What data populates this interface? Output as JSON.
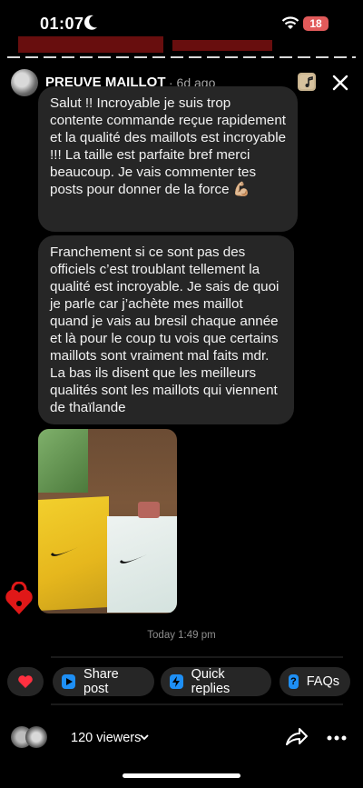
{
  "status_bar": {
    "time": "01:07",
    "battery": "18"
  },
  "story": {
    "username": "PREUVE MAILLOT",
    "age": "· 6d ago"
  },
  "messages": [
    {
      "text": "Salut !! Incroyable je suis trop contente commande reçue rapidement et la qualité des maillots est incroyable !!! La taille est parfaite bref merci beaucoup. Je vais commenter tes posts pour donner de la force 💪🏼"
    },
    {
      "text": "Franchement si ce sont pas des officiels c’est troublant tellement la qualité est incroyable. Je sais de quoi je parle car j’achète mes maillot quand je vais au bresil chaque année et là pour le coup tu vois que certains maillots sont vraiment mal faits mdr. La bas ils disent que les meilleurs qualités sont les maillots qui viennent de thaïlande"
    }
  ],
  "timestamp": "Today 1:49 pm",
  "actions": {
    "share": "Share post",
    "quick_replies": "Quick replies",
    "faqs": "FAQs"
  },
  "footer": {
    "viewers": "120 viewers"
  },
  "colors": {
    "bubble": "#262626",
    "accent": "#1e8ff5",
    "heart": "#ff3040"
  }
}
